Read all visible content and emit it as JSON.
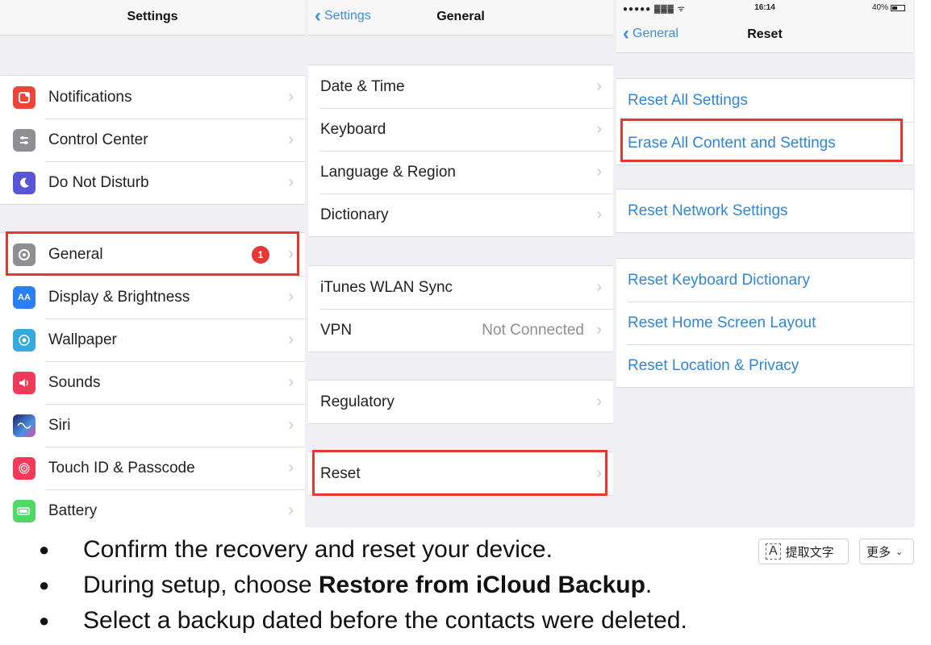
{
  "panel_settings": {
    "title": "Settings",
    "group1": [
      {
        "label": "Notifications",
        "icon": "notifications-icon",
        "color": "#f0443a"
      },
      {
        "label": "Control Center",
        "icon": "control-center-icon",
        "color": "#8e8e93"
      },
      {
        "label": "Do Not Disturb",
        "icon": "moon-icon",
        "color": "#5856d6"
      }
    ],
    "group2": [
      {
        "label": "General",
        "icon": "gear-icon",
        "color": "#8e8e93",
        "badge": "1"
      },
      {
        "label": "Display & Brightness",
        "icon": "display-icon",
        "color": "#2b7ff5"
      },
      {
        "label": "Wallpaper",
        "icon": "wallpaper-icon",
        "color": "#36aadc"
      },
      {
        "label": "Sounds",
        "icon": "sounds-icon",
        "color": "#f03a5a"
      },
      {
        "label": "Siri",
        "icon": "siri-icon",
        "color": "#3a3a8c"
      },
      {
        "label": "Touch ID & Passcode",
        "icon": "fingerprint-icon",
        "color": "#f03a5a"
      },
      {
        "label": "Battery",
        "icon": "battery-icon",
        "color": "#4cd964"
      }
    ]
  },
  "panel_general": {
    "back": "Settings",
    "title": "General",
    "group1": [
      "Date & Time",
      "Keyboard",
      "Language & Region",
      "Dictionary"
    ],
    "group2": [
      {
        "label": "iTunes WLAN Sync"
      },
      {
        "label": "VPN",
        "detail": "Not Connected"
      }
    ],
    "group3": [
      "Regulatory"
    ],
    "group4": [
      "Reset"
    ]
  },
  "panel_reset": {
    "status_time": "16:14",
    "status_battery": "40%",
    "back": "General",
    "title": "Reset",
    "items": [
      "Reset All Settings",
      "Erase All Content and Settings",
      "Reset Network Settings",
      "Reset Keyboard Dictionary",
      "Reset Home Screen Layout",
      "Reset Location & Privacy"
    ]
  },
  "steps": [
    {
      "text": "Confirm the recovery and reset your device."
    },
    {
      "pre": "During setup, choose ",
      "bold": "Restore from iCloud Backup",
      "post": "."
    },
    {
      "text": "Select a backup dated before the contacts were deleted."
    }
  ],
  "toolbar": {
    "ocr_label": "提取文字",
    "more_label": "更多"
  },
  "colors": {
    "highlight": "#e4382f",
    "link_blue": "#2f86d9",
    "badge_red": "#e53935"
  }
}
